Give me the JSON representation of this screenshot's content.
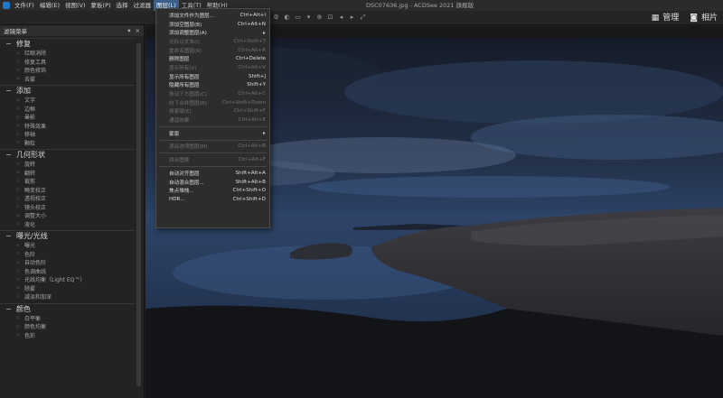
{
  "window": {
    "title": "DSC07636.jpg - ACDSee 2021 旗舰版"
  },
  "menubar": {
    "items": [
      {
        "label": "文件(F)"
      },
      {
        "label": "编辑(E)"
      },
      {
        "label": "视图(V)"
      },
      {
        "label": "蒙板(P)"
      },
      {
        "label": "选择"
      },
      {
        "label": "过滤器"
      },
      {
        "label": "图层(L)"
      },
      {
        "label": "工具(T)"
      },
      {
        "label": "帮助(H)"
      }
    ]
  },
  "mode_tabs": [
    {
      "label": "管理",
      "icon": "grid-icon"
    },
    {
      "label": "相片",
      "icon": "camera-icon"
    }
  ],
  "panel": {
    "title": "滤镜菜单",
    "groups": [
      {
        "title": "修复",
        "items": [
          {
            "label": "红眼消除",
            "icon": "eye-icon"
          },
          {
            "label": "修复工具",
            "icon": "bandage-icon"
          },
          {
            "label": "颜色修饰",
            "icon": "palette-icon"
          },
          {
            "label": "去雾",
            "icon": "fog-icon"
          }
        ]
      },
      {
        "title": "添加",
        "items": [
          {
            "label": "文字",
            "icon": "text-icon"
          },
          {
            "label": "边框",
            "icon": "border-icon"
          },
          {
            "label": "晕影",
            "icon": "vignette-icon"
          },
          {
            "label": "特殊效果",
            "icon": "effects-icon"
          },
          {
            "label": "移轴",
            "icon": "tiltshift-icon"
          },
          {
            "label": "颗粒",
            "icon": "grain-icon"
          }
        ]
      },
      {
        "title": "几何形状",
        "items": [
          {
            "label": "旋转",
            "icon": "rotate-icon"
          },
          {
            "label": "翻转",
            "icon": "flip-icon"
          },
          {
            "label": "裁剪",
            "icon": "crop-icon"
          },
          {
            "label": "畸变校正",
            "icon": "distortion-icon"
          },
          {
            "label": "透视校正",
            "icon": "perspective-icon"
          },
          {
            "label": "镜头校正",
            "icon": "lens-icon"
          },
          {
            "label": "调整大小",
            "icon": "resize-icon"
          },
          {
            "label": "液化",
            "icon": "liquify-icon"
          }
        ]
      },
      {
        "title": "曝光/光线",
        "items": [
          {
            "label": "曝光",
            "icon": "exposure-icon"
          },
          {
            "label": "色阶",
            "icon": "levels-icon"
          },
          {
            "label": "自动色阶",
            "icon": "auto-levels-icon"
          },
          {
            "label": "色调曲线",
            "icon": "curves-icon"
          },
          {
            "label": "光线均衡（Light EQ™）",
            "icon": "light-eq-icon"
          },
          {
            "label": "除雾",
            "icon": "dehaze-icon"
          },
          {
            "label": "减淡和加深",
            "icon": "dodge-burn-icon"
          }
        ]
      },
      {
        "title": "颜色",
        "items": [
          {
            "label": "白平衡",
            "icon": "white-balance-icon"
          },
          {
            "label": "颜色均衡",
            "icon": "color-eq-icon"
          },
          {
            "label": "色彩",
            "icon": "color-icon"
          }
        ]
      }
    ]
  },
  "dropdown": {
    "items": [
      {
        "label": "添加文件作为图层...",
        "shortcut": "Ctrl+Alt+I",
        "disabled": false
      },
      {
        "label": "添加空图层(B)",
        "shortcut": "Ctrl+Alt+N",
        "disabled": false
      },
      {
        "label": "添加调整图层(A)",
        "shortcut": "",
        "submenu": true,
        "disabled": false
      },
      {
        "label": "光标以文本(I)",
        "shortcut": "Ctrl+Shift+T",
        "disabled": true
      },
      {
        "label": "重命名图层(R)",
        "shortcut": "Ctrl+Alt+R",
        "disabled": true
      },
      {
        "label": "删除图层",
        "shortcut": "Ctrl+Delete",
        "disabled": false
      },
      {
        "label": "显示所有(V)",
        "shortcut": "Ctrl+Alt+V",
        "disabled": true
      },
      {
        "label": "显示所有图层",
        "shortcut": "Shift+J",
        "disabled": false
      },
      {
        "label": "隐藏所有图层",
        "shortcut": "Shift+Y",
        "disabled": false
      },
      {
        "label": "移动下方图层(C)",
        "shortcut": "Ctrl+Alt+C",
        "disabled": true
      },
      {
        "label": "向下合并图层(R)",
        "shortcut": "Ctrl+Shift+Down",
        "disabled": true
      },
      {
        "label": "用蒙版(E)",
        "shortcut": "Ctrl+Shift+F",
        "disabled": true
      },
      {
        "label": "通道效果",
        "shortcut": "Ctrl+Alt+E",
        "disabled": true
      },
      {
        "sep": true
      },
      {
        "label": "蒙版",
        "shortcut": "",
        "submenu": true,
        "disabled": false
      },
      {
        "sep": true
      },
      {
        "label": "混合选项图层(M)",
        "shortcut": "Ctrl+Alt+B",
        "disabled": true
      },
      {
        "sep": true
      },
      {
        "label": "拼合图像",
        "shortcut": "Ctrl+Alt+F",
        "disabled": true
      },
      {
        "sep": true
      },
      {
        "label": "自动对齐图层",
        "shortcut": "Shift+Alt+A",
        "disabled": false
      },
      {
        "label": "自动混合图层...",
        "shortcut": "Shift+Alt+B",
        "disabled": false
      },
      {
        "label": "焦点堆栈...",
        "shortcut": "Ctrl+Shift+O",
        "disabled": false
      },
      {
        "label": "HDR...",
        "shortcut": "Ctrl+Shift+D",
        "disabled": false
      }
    ]
  }
}
